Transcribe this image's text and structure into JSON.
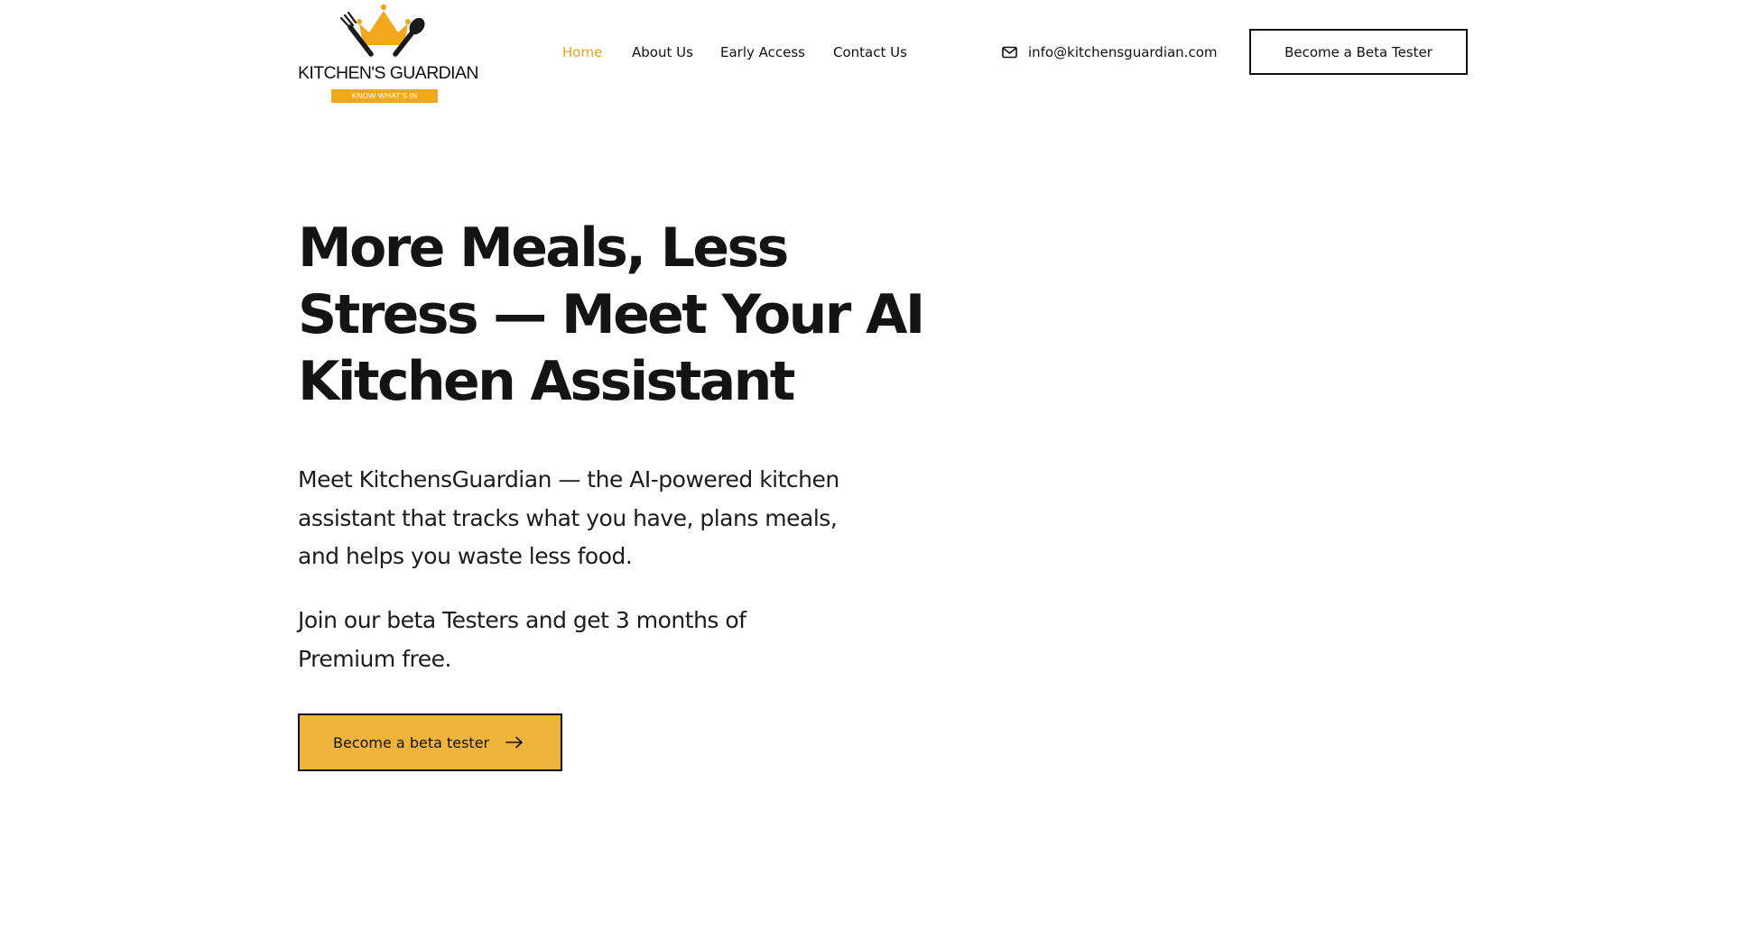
{
  "brand": {
    "name": "KITCHEN'S GUARDIAN",
    "tagline": "KNOW WHAT'S IN",
    "colors": {
      "accent": "#e8a11c",
      "crown": "#f2a81d",
      "cta_fill": "#efb43c",
      "text": "#141414"
    }
  },
  "nav": {
    "items": [
      {
        "label": "Home",
        "active": true
      },
      {
        "label": "About Us",
        "active": false
      },
      {
        "label": "Early Access",
        "active": false
      },
      {
        "label": "Contact Us",
        "active": false
      }
    ]
  },
  "contact": {
    "icon": "envelope-icon",
    "email": "info@kitchensguardian.com"
  },
  "header_cta": {
    "label": "Become a Beta Tester"
  },
  "hero": {
    "title": "More Meals, Less Stress — Meet Your AI Kitchen Assistant",
    "description": "Meet KitchensGuardian — the AI-powered kitchen assistant that tracks what you have, plans meals, and helps you waste less food.",
    "offer": "Join our beta Testers and get 3 months of Premium free.",
    "cta": {
      "label": "Become a beta tester",
      "icon": "arrow-right-icon"
    }
  }
}
